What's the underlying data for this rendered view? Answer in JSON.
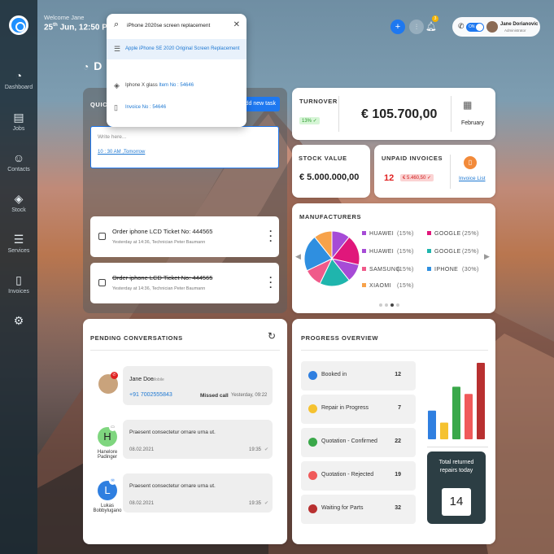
{
  "header": {
    "welcome": "Welcome Jane",
    "date": "25",
    "date_sup": "th",
    "date_rest": " Jun, 12:50 PM",
    "page_initial": "D"
  },
  "user": {
    "name": "Jane Dorianovic",
    "role": "Administrator",
    "toggle": "ON",
    "notifications": "3"
  },
  "sidebar": {
    "items": [
      {
        "label": "Dashboard",
        "icon": "dashboard-icon"
      },
      {
        "label": "Jobs",
        "icon": "jobs-icon"
      },
      {
        "label": "Contacts",
        "icon": "contacts-icon"
      },
      {
        "label": "Stock",
        "icon": "stock-icon"
      },
      {
        "label": "Services",
        "icon": "services-icon"
      },
      {
        "label": "Invoices",
        "icon": "invoices-icon"
      }
    ]
  },
  "search": {
    "value": "iPhone 2020se screen replacement",
    "results": [
      {
        "text": "Apple iPhone SE 2020 Original Screen Replacement",
        "icon": "list-icon"
      },
      {
        "text": "Iphone X glass",
        "extra": "Item No : 54646",
        "icon": "layers-icon"
      },
      {
        "text": "Invoice No : 54646",
        "icon": "document-icon"
      }
    ]
  },
  "quick": {
    "title": "QUICK",
    "add_button": "Add new task",
    "placeholder": "Write here...",
    "time_link": "10 : 30 AM ,Tomorrow",
    "orders": [
      {
        "title": "Order iphone LCD Ticket No: 444565",
        "sub": "Yesterday at 14:36, Technician Peter Baumann",
        "done": false
      },
      {
        "title": "Order iphone LCD Ticket No: 444565",
        "sub": "Yesterday at 14:36, Technician Peter Baumann",
        "done": true
      }
    ]
  },
  "turnover": {
    "label": "TURNOVER",
    "value": "€ 105.700,00",
    "change": "13%",
    "month": "February"
  },
  "stock": {
    "label": "STOCK VALUE",
    "value": "€ 5.000.000,00"
  },
  "unpaid": {
    "label": "UNPAID INVOICES",
    "count": "12",
    "amount": "€ 5.460,50",
    "link": "Invoice List"
  },
  "manufacturers": {
    "title": "MANUFACTURERS",
    "legend": [
      {
        "name": "HUAWEI",
        "pct": "(15%)",
        "color": "#a64bd6"
      },
      {
        "name": "GOOGLE",
        "pct": "(25%)",
        "color": "#e0177b"
      },
      {
        "name": "HUAWEI",
        "pct": "(15%)",
        "color": "#a64bd6"
      },
      {
        "name": "GOOGLE",
        "pct": "(25%)",
        "color": "#1fb5ad"
      },
      {
        "name": "SAMSUNG",
        "pct": "(15%)",
        "color": "#f05a8a"
      },
      {
        "name": "IPHONE",
        "pct": "(30%)",
        "color": "#2f8fe0"
      },
      {
        "name": "XIAOMI",
        "pct": "(15%)",
        "color": "#f7a24a"
      }
    ]
  },
  "conversations": {
    "title": "PENDING CONVERSATIONS",
    "items": [
      {
        "name": "Jane Doe",
        "tag": "Mobile",
        "phone": "+91 7002555843",
        "status": "Missed call",
        "time": "Yesterday, 09:22"
      },
      {
        "initial": "H",
        "person": "Hanelore Padinger",
        "text": "Praesent consectetur ornare urna ut.",
        "date": "08.02.2021",
        "time": "19:35"
      },
      {
        "initial": "L",
        "person": "Lukas Bobbylugano",
        "text": "Praesent consectetur ornare urna ut.",
        "date": "08.02.2021",
        "time": "19:35"
      }
    ]
  },
  "progress": {
    "title": "PROGRESS OVERVIEW",
    "items": [
      {
        "label": "Booked in",
        "count": "12",
        "color": "#2f7fe0"
      },
      {
        "label": "Repair in Progress",
        "count": "7",
        "color": "#f5c230"
      },
      {
        "label": "Quotation - Confirmed",
        "count": "22",
        "color": "#3aa84a"
      },
      {
        "label": "Quotation - Rejected",
        "count": "19",
        "color": "#f05a5a"
      },
      {
        "label": "Waiting for Parts",
        "count": "32",
        "color": "#b83030"
      }
    ],
    "returned_label": "Total returned repairs today",
    "returned_value": "14"
  },
  "chart_data": [
    {
      "type": "pie",
      "title": "MANUFACTURERS",
      "categories": [
        "HUAWEI",
        "GOOGLE",
        "HUAWEI",
        "GOOGLE",
        "SAMSUNG",
        "IPHONE",
        "XIAOMI"
      ],
      "values": [
        15,
        25,
        15,
        25,
        15,
        30,
        15
      ],
      "colors": [
        "#a64bd6",
        "#e0177b",
        "#a64bd6",
        "#1fb5ad",
        "#f05a8a",
        "#2f8fe0",
        "#f7a24a"
      ]
    },
    {
      "type": "bar",
      "title": "PROGRESS OVERVIEW",
      "categories": [
        "Booked in",
        "Repair in Progress",
        "Quotation - Confirmed",
        "Quotation - Rejected",
        "Waiting for Parts"
      ],
      "values": [
        12,
        7,
        22,
        19,
        32
      ],
      "colors": [
        "#2f7fe0",
        "#f5c230",
        "#3aa84a",
        "#f05a5a",
        "#b83030"
      ]
    }
  ]
}
